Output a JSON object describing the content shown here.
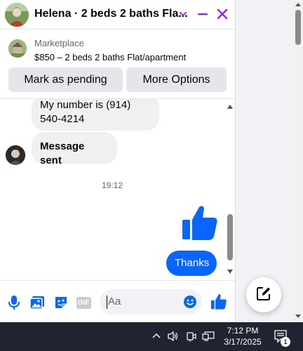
{
  "colors": {
    "accent": "#a020f0",
    "brand": "#0866ff",
    "bubble_in": "#f0f0f0",
    "taskbar": "#1f2430"
  },
  "header": {
    "title": "Helena · 2 beds 2 baths Fla...",
    "icons": [
      "chevron-down-icon",
      "minimize-icon",
      "close-icon"
    ]
  },
  "marketplace": {
    "label": "Marketplace",
    "listing": "$850 – 2 beds 2 baths Flat/apartment",
    "pending_button": "Mark as pending",
    "options_button": "More Options"
  },
  "messages": [
    {
      "direction": "incoming",
      "text_line1": "My number is (914)",
      "text_line2": "540-4214"
    },
    {
      "direction": "incoming",
      "text": "Message sent"
    },
    {
      "type": "timestamp",
      "text": "19:12"
    },
    {
      "direction": "outgoing",
      "type": "like-sticker",
      "icon": "thumbs-up-icon"
    },
    {
      "direction": "outgoing",
      "text": "Thanks"
    }
  ],
  "composer": {
    "placeholder": "Aa",
    "icons": [
      "microphone-icon",
      "photo-icon",
      "sticker-icon",
      "gif-icon",
      "emoji-icon",
      "thumbs-up-icon"
    ],
    "gif_label": "GIF"
  },
  "new_message_icon": "compose-icon",
  "taskbar": {
    "time": "7:12 PM",
    "date": "3/17/2025",
    "notification_count": "1",
    "icons": [
      "chevron-up-icon",
      "speaker-icon",
      "camera-icon",
      "network-icon",
      "notification-icon"
    ]
  }
}
